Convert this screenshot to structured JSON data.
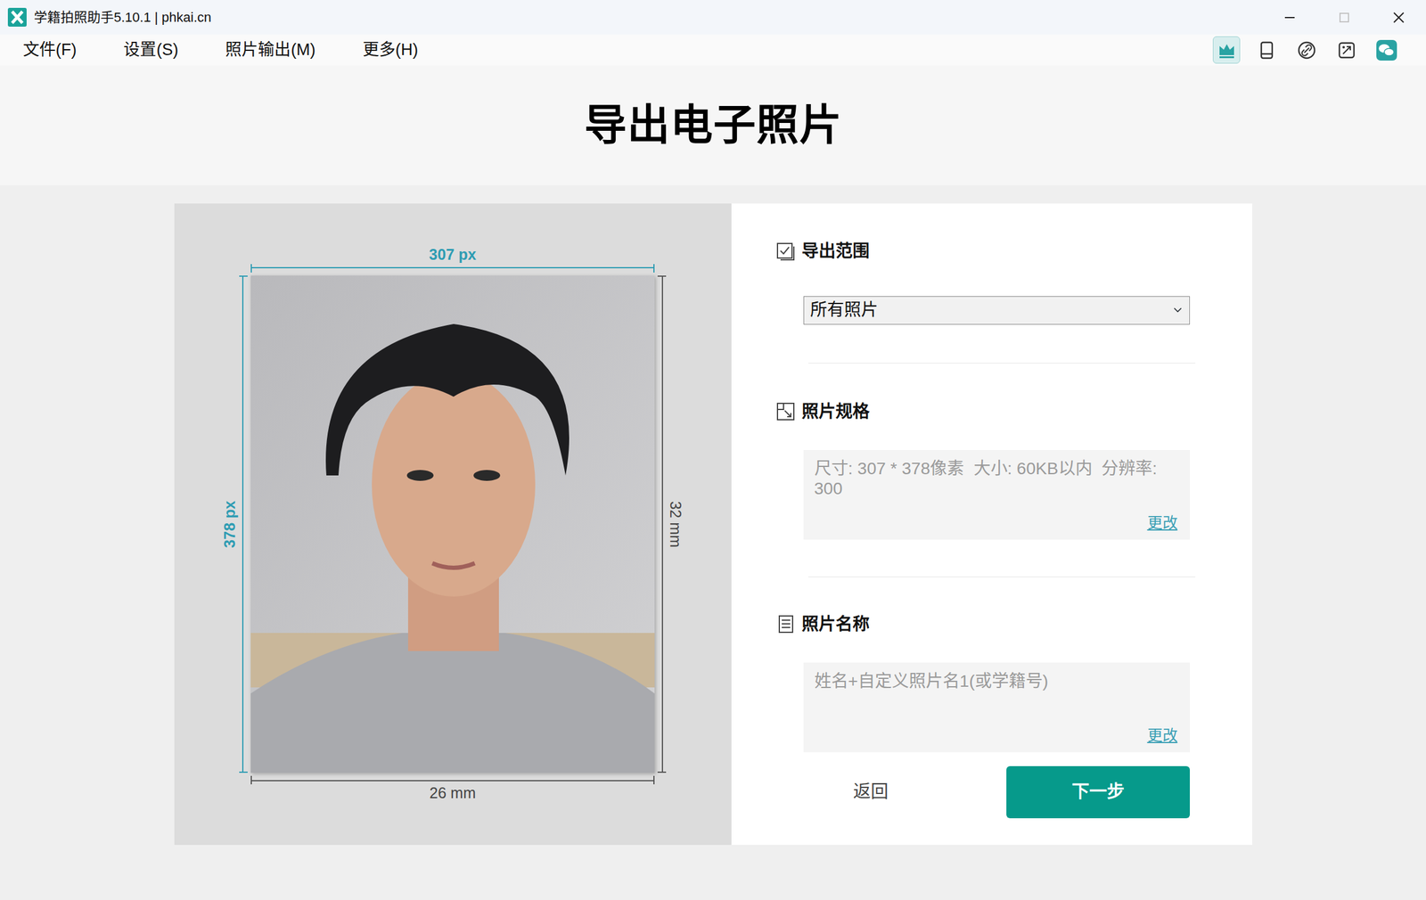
{
  "window": {
    "title": "学籍拍照助手5.10.1 | phkai.cn",
    "controls": [
      {
        "disabled": false
      },
      {
        "disabled": true
      },
      {
        "disabled": false
      }
    ]
  },
  "menu": [
    "文件(F)",
    "设置(S)",
    "照片输出(M)",
    "更多(H)"
  ],
  "toolbar": [
    {
      "selected": true
    },
    {
      "selected": false
    },
    {
      "selected": false
    },
    {
      "selected": false
    },
    {
      "selected": false
    }
  ],
  "page_title": "导出电子照片",
  "preview": {
    "width_px": "307 px",
    "height_px": "378 px",
    "width_mm": "26 mm",
    "height_mm": "32 mm"
  },
  "export_range": {
    "label": "导出范围",
    "value": "所有照片"
  },
  "spec": {
    "label": "照片规格",
    "text": "尺寸: 307 * 378像素  大小: 60KB以内  分辨率: 300",
    "link": "更改"
  },
  "naming": {
    "label": "照片名称",
    "text": "姓名+自定义照片名1(或学籍号)",
    "link": "更改"
  },
  "buttons": [
    {
      "label": "返回",
      "kind": "link"
    },
    {
      "label": "下一步",
      "kind": "primary"
    }
  ]
}
